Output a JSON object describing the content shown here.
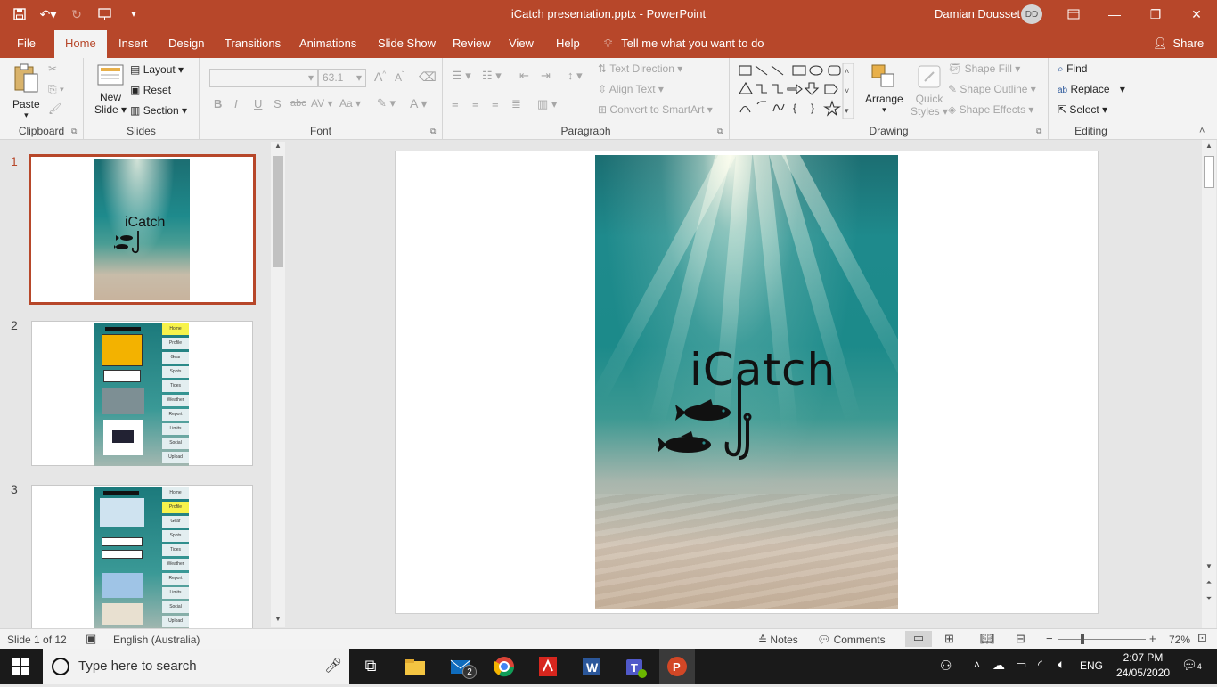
{
  "app": {
    "title": "iCatch presentation.pptx  -  PowerPoint",
    "user_name": "Damian Dousset",
    "user_initials": "DD",
    "accent": "#b7472a"
  },
  "tabs": [
    "File",
    "Home",
    "Insert",
    "Design",
    "Transitions",
    "Animations",
    "Slide Show",
    "Review",
    "View",
    "Help"
  ],
  "tell_me": "Tell me what you want to do",
  "share": "Share",
  "ribbon": {
    "clipboard": {
      "label": "Clipboard",
      "paste": "Paste"
    },
    "slides": {
      "label": "Slides",
      "new_slide_1": "New",
      "new_slide_2": "Slide",
      "layout": "Layout",
      "reset": "Reset",
      "section": "Section"
    },
    "font": {
      "label": "Font",
      "size": "63.1",
      "bold": "B",
      "italic": "I",
      "underline": "U",
      "shadow": "S",
      "strike": "abc",
      "case": "Aa",
      "grow": "A",
      "shrink": "A",
      "color": "A"
    },
    "paragraph": {
      "label": "Paragraph",
      "text_direction": "Text Direction",
      "align_text": "Align Text",
      "convert_smartart": "Convert to SmartArt"
    },
    "drawing": {
      "label": "Drawing",
      "arrange": "Arrange",
      "quick_styles_1": "Quick",
      "quick_styles_2": "Styles",
      "shape_fill": "Shape Fill",
      "shape_outline": "Shape Outline",
      "shape_effects": "Shape Effects"
    },
    "editing": {
      "label": "Editing",
      "find": "Find",
      "replace": "Replace",
      "select": "Select"
    }
  },
  "thumbnails": [
    {
      "number": "1",
      "title": "iCatch"
    },
    {
      "number": "2",
      "nav": [
        "Home",
        "Profile",
        "Gear",
        "Spots",
        "Tides",
        "Weather",
        "Report",
        "Limits",
        "Social",
        "Upload"
      ]
    },
    {
      "number": "3",
      "nav": [
        "Home",
        "Profile",
        "Gear",
        "Spots",
        "Tides",
        "Weather",
        "Report",
        "Limits",
        "Social",
        "Upload"
      ]
    }
  ],
  "slide": {
    "title": "iCatch"
  },
  "status": {
    "slide_info": "Slide 1 of 12",
    "language": "English (Australia)",
    "notes": "Notes",
    "comments": "Comments",
    "zoom": "72%",
    "zoom_level": 0.72
  },
  "taskbar": {
    "search_placeholder": "Type here to search",
    "mail_badge": "2",
    "lang": "ENG",
    "time": "2:07 PM",
    "date": "24/05/2020",
    "notif_count": "4"
  }
}
